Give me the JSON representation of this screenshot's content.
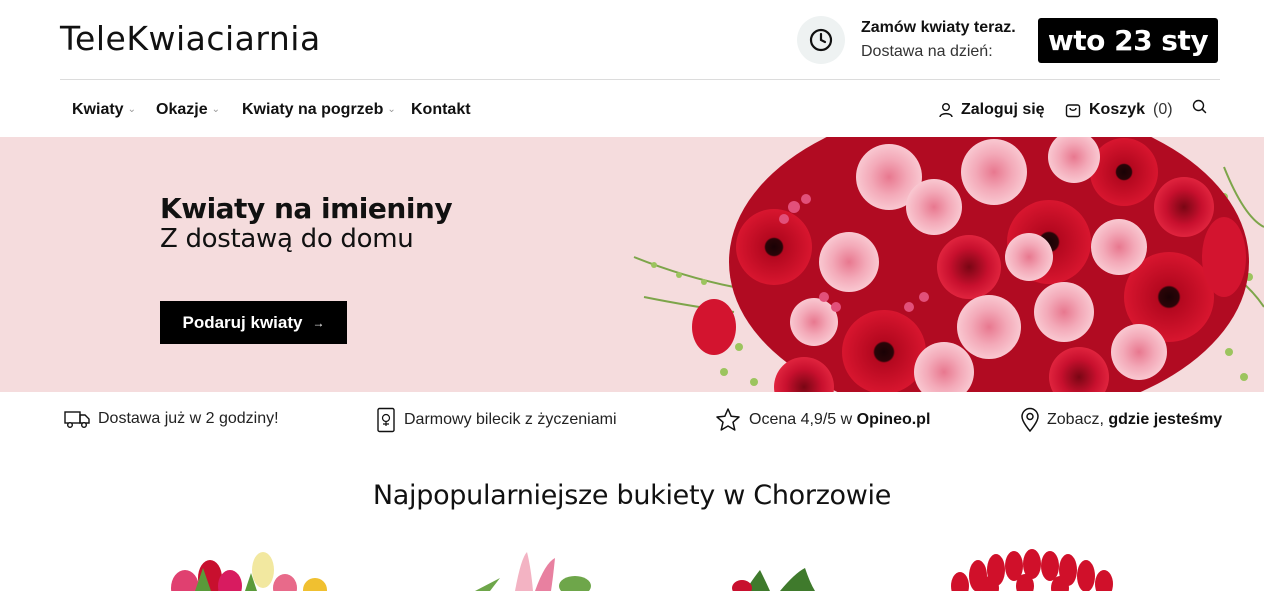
{
  "header": {
    "logo": "TeleKwiaciarnia",
    "order_title": "Zamów kwiaty teraz.",
    "order_sub": "Dostawa na dzień:",
    "delivery_date": "wto 23 sty"
  },
  "nav": {
    "items": [
      {
        "label": "Kwiaty",
        "dropdown": true
      },
      {
        "label": "Okazje",
        "dropdown": true
      },
      {
        "label": "Kwiaty na pogrzeb",
        "dropdown": true
      },
      {
        "label": "Kontakt",
        "dropdown": false
      }
    ],
    "login": "Zaloguj się",
    "cart": "Koszyk",
    "cart_count": "(0)"
  },
  "hero": {
    "title": "Kwiaty na imieniny",
    "subtitle": "Z dostawą do domu",
    "button": "Podaruj kwiaty",
    "background": "#f5dcdd"
  },
  "features": [
    {
      "icon": "truck-icon",
      "text": "Dostawa już w 2 godziny!",
      "bold": ""
    },
    {
      "icon": "card-icon",
      "text": "Darmowy bilecik z życzeniami",
      "bold": ""
    },
    {
      "icon": "star-icon",
      "text": "Ocena 4,9/5 w ",
      "bold": "Opineo.pl"
    },
    {
      "icon": "location-pin-icon",
      "text": "Zobacz, ",
      "bold": "gdzie jesteśmy"
    }
  ],
  "section": {
    "title": "Najpopularniejsze bukiety w Chorzowie"
  },
  "colors": {
    "accent": "#000000",
    "hero_bg": "#f5dcdd",
    "rose_red": "#c8102e",
    "rose_pink": "#f2a5b3"
  }
}
